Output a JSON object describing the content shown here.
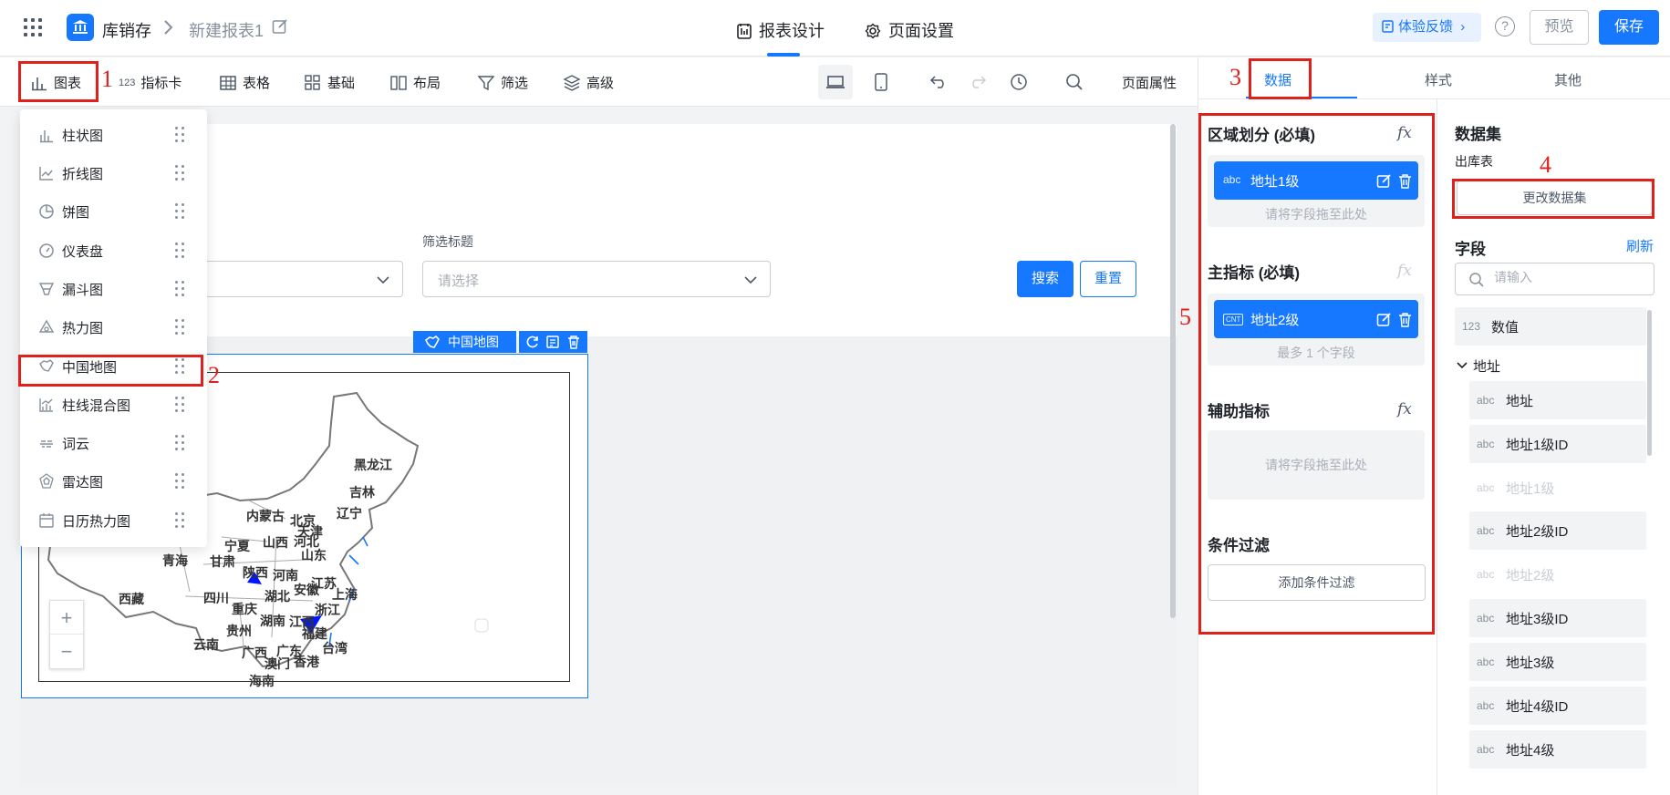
{
  "header": {
    "app_name": "库销存",
    "doc_name": "新建报表1",
    "tabs": [
      {
        "label": "报表设计"
      },
      {
        "label": "页面设置"
      }
    ],
    "feedback_label": "体验反馈",
    "help_label": "?",
    "preview_label": "预览",
    "save_label": "保存",
    "accent_color": "#1677ff"
  },
  "toolbar": {
    "items": [
      {
        "label": "图表",
        "icon": "bar-chart-icon"
      },
      {
        "label": "指标卡",
        "icon": "metric-123-icon",
        "prefix": "123"
      },
      {
        "label": "表格",
        "icon": "table-icon"
      },
      {
        "label": "基础",
        "icon": "grid-icon"
      },
      {
        "label": "布局",
        "icon": "layout-icon"
      },
      {
        "label": "筛选",
        "icon": "filter-icon"
      },
      {
        "label": "高级",
        "icon": "layers-icon"
      }
    ],
    "page_props_label": "页面属性"
  },
  "chart_menu": {
    "items": [
      {
        "label": "柱状图",
        "icon": "bar-chart-icon"
      },
      {
        "label": "折线图",
        "icon": "line-chart-icon"
      },
      {
        "label": "饼图",
        "icon": "pie-chart-icon"
      },
      {
        "label": "仪表盘",
        "icon": "gauge-icon"
      },
      {
        "label": "漏斗图",
        "icon": "funnel-icon"
      },
      {
        "label": "热力图",
        "icon": "heatmap-icon"
      },
      {
        "label": "中国地图",
        "icon": "china-map-icon"
      },
      {
        "label": "柱线混合图",
        "icon": "combo-chart-icon"
      },
      {
        "label": "词云",
        "icon": "word-cloud-icon"
      },
      {
        "label": "雷达图",
        "icon": "radar-icon"
      },
      {
        "label": "日历热力图",
        "icon": "calendar-icon"
      }
    ]
  },
  "canvas": {
    "filter_title": "筛选标题",
    "select_placeholder": "请选择",
    "search_label": "搜索",
    "reset_label": "重置",
    "map_tag_label": "中国地图",
    "zoom_in": "+",
    "zoom_out": "−",
    "provinces": [
      "黑龙江",
      "吉林",
      "辽宁",
      "内蒙古",
      "北京",
      "天津",
      "宁夏",
      "山西",
      "河北",
      "山东",
      "青海",
      "甘肃",
      "陕西",
      "河南",
      "江苏",
      "西藏",
      "四川",
      "湖北",
      "安徽",
      "上海",
      "重庆",
      "浙江",
      "湖南",
      "江西",
      "贵州",
      "福建",
      "云南",
      "广西",
      "广东",
      "台湾",
      "澳门",
      "香港",
      "海南"
    ]
  },
  "annotations": {
    "n1": "1",
    "n2": "2",
    "n3": "3",
    "n4": "4",
    "n5": "5",
    "color": "#e0201b"
  },
  "right_panel": {
    "tabs": [
      {
        "label": "数据"
      },
      {
        "label": "样式"
      },
      {
        "label": "其他"
      }
    ],
    "region_title": "区域划分 (必填)",
    "region_field": {
      "type": "abc",
      "name": "地址1级"
    },
    "region_hint": "请将字段拖至此处",
    "main_metric_title": "主指标 (必填)",
    "main_metric_field": {
      "type": "CNT",
      "name": "地址2级"
    },
    "main_metric_hint": "最多 1 个字段",
    "aux_metric_title": "辅助指标",
    "aux_metric_hint": "请将字段拖至此处",
    "condition_title": "条件过滤",
    "add_condition_label": "添加条件过滤",
    "fx_label": "fx",
    "dataset_title": "数据集",
    "dataset_name": "出库表",
    "change_dataset_label": "更改数据集",
    "fields_title": "字段",
    "refresh_label": "刷新",
    "search_placeholder": "请输入",
    "numeric_field": {
      "type": "123",
      "name": "数值"
    },
    "group_label": "地址",
    "fields": [
      {
        "type": "abc",
        "name": "地址",
        "disabled": false
      },
      {
        "type": "abc",
        "name": "地址1级ID",
        "disabled": false
      },
      {
        "type": "abc",
        "name": "地址1级",
        "disabled": true
      },
      {
        "type": "abc",
        "name": "地址2级ID",
        "disabled": false
      },
      {
        "type": "abc",
        "name": "地址2级",
        "disabled": true
      },
      {
        "type": "abc",
        "name": "地址3级ID",
        "disabled": false
      },
      {
        "type": "abc",
        "name": "地址3级",
        "disabled": false
      },
      {
        "type": "abc",
        "name": "地址4级ID",
        "disabled": false
      },
      {
        "type": "abc",
        "name": "地址4级",
        "disabled": false
      }
    ]
  }
}
